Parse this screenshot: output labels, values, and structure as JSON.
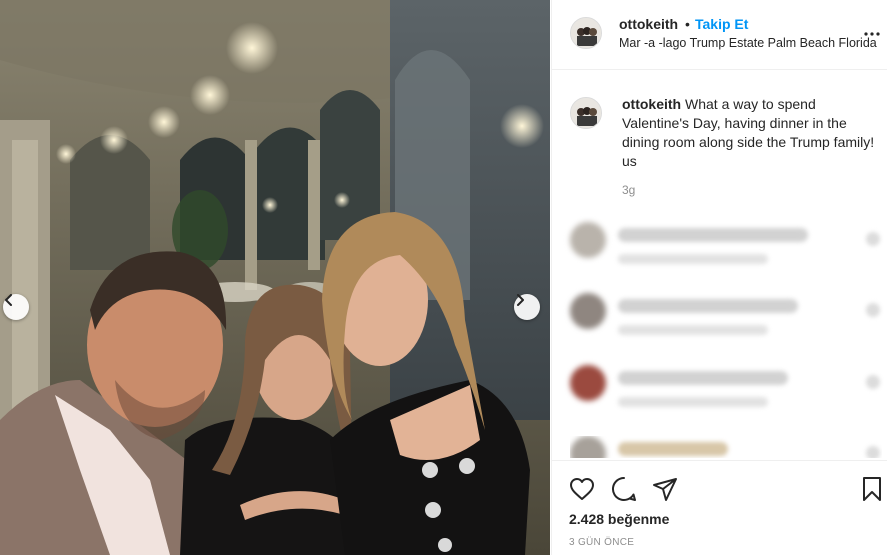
{
  "post": {
    "username": "ottokeith",
    "dot": "•",
    "follow_label": "Takip Et",
    "location": "Mar -a -lago Trump Estate Palm Beach Florida"
  },
  "caption": {
    "username": "ottokeith",
    "text": "What a way to spend Valentine's Day, having dinner in the dining room along side the Trump family! us",
    "time": "3g"
  },
  "comments": [
    {
      "state": "blurred"
    },
    {
      "state": "blurred"
    },
    {
      "state": "blurred"
    },
    {
      "state": "blurred"
    }
  ],
  "actions": {
    "icons": [
      "heart-icon",
      "comment-icon",
      "share-icon",
      "bookmark-icon"
    ],
    "likes": "2.428 beğenme",
    "ago": "3 GÜN ÖNCE"
  },
  "colors": {
    "accent": "#0095f6",
    "text": "#262626",
    "muted": "#8e8e8e",
    "border": "#efefef"
  }
}
